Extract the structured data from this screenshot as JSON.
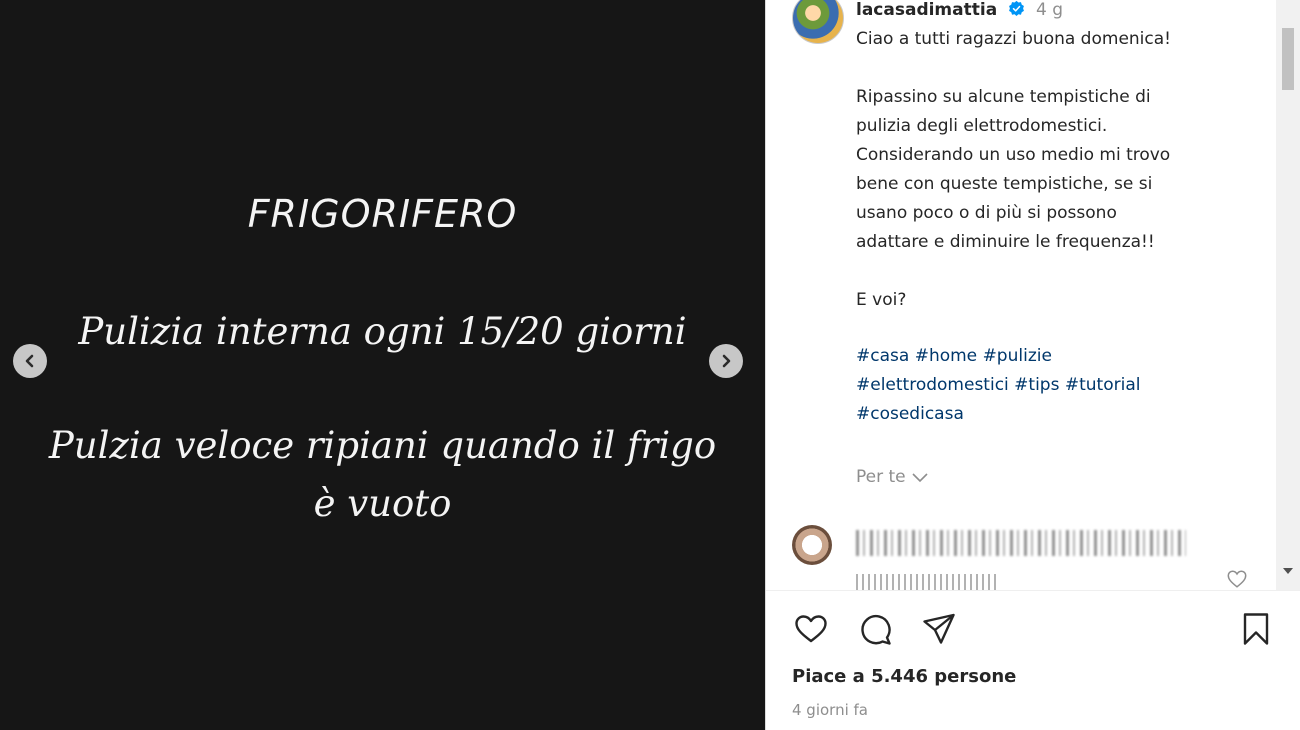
{
  "slide": {
    "heading": "FRIGORIFERO",
    "line1": "Pulizia interna ogni 15/20 giorni",
    "line2": "Pulzia veloce ripiani quando il frigo è vuoto"
  },
  "post": {
    "username": "lacasadimattia",
    "time_ago": "4 g",
    "caption": [
      "Ciao a tutti ragazzi buona domenica!",
      "Ripassino su alcune tempistiche di",
      "pulizia degli elettrodomestici.",
      "Considerando un uso medio mi trovo",
      "bene con queste tempistiche, se si",
      "usano poco o di più si possono",
      "adattare e diminuire le frequenza!!",
      "E voi?"
    ],
    "hashtags": {
      "casa": "#casa",
      "home": "#home",
      "pulizie": "#pulizie",
      "elettrodomestici": "#elettrodomestici",
      "tips": "#tips",
      "tutorial": "#tutorial",
      "cosedicasa": "#cosedicasa"
    },
    "per_te": "Per te",
    "likes": "Piace a 5.446 persone",
    "date": "4 giorni fa"
  },
  "icons": {
    "nav_prev": "chevron-left-icon",
    "nav_next": "chevron-right-icon",
    "verified": "verified-badge-icon",
    "like": "heart-icon",
    "comment": "comment-bubble-icon",
    "share": "paper-plane-icon",
    "save": "bookmark-icon"
  },
  "colors": {
    "media_bg": "#161616",
    "hashtag": "#00376b",
    "verified": "#0095f6",
    "muted": "#8e8e8e"
  }
}
